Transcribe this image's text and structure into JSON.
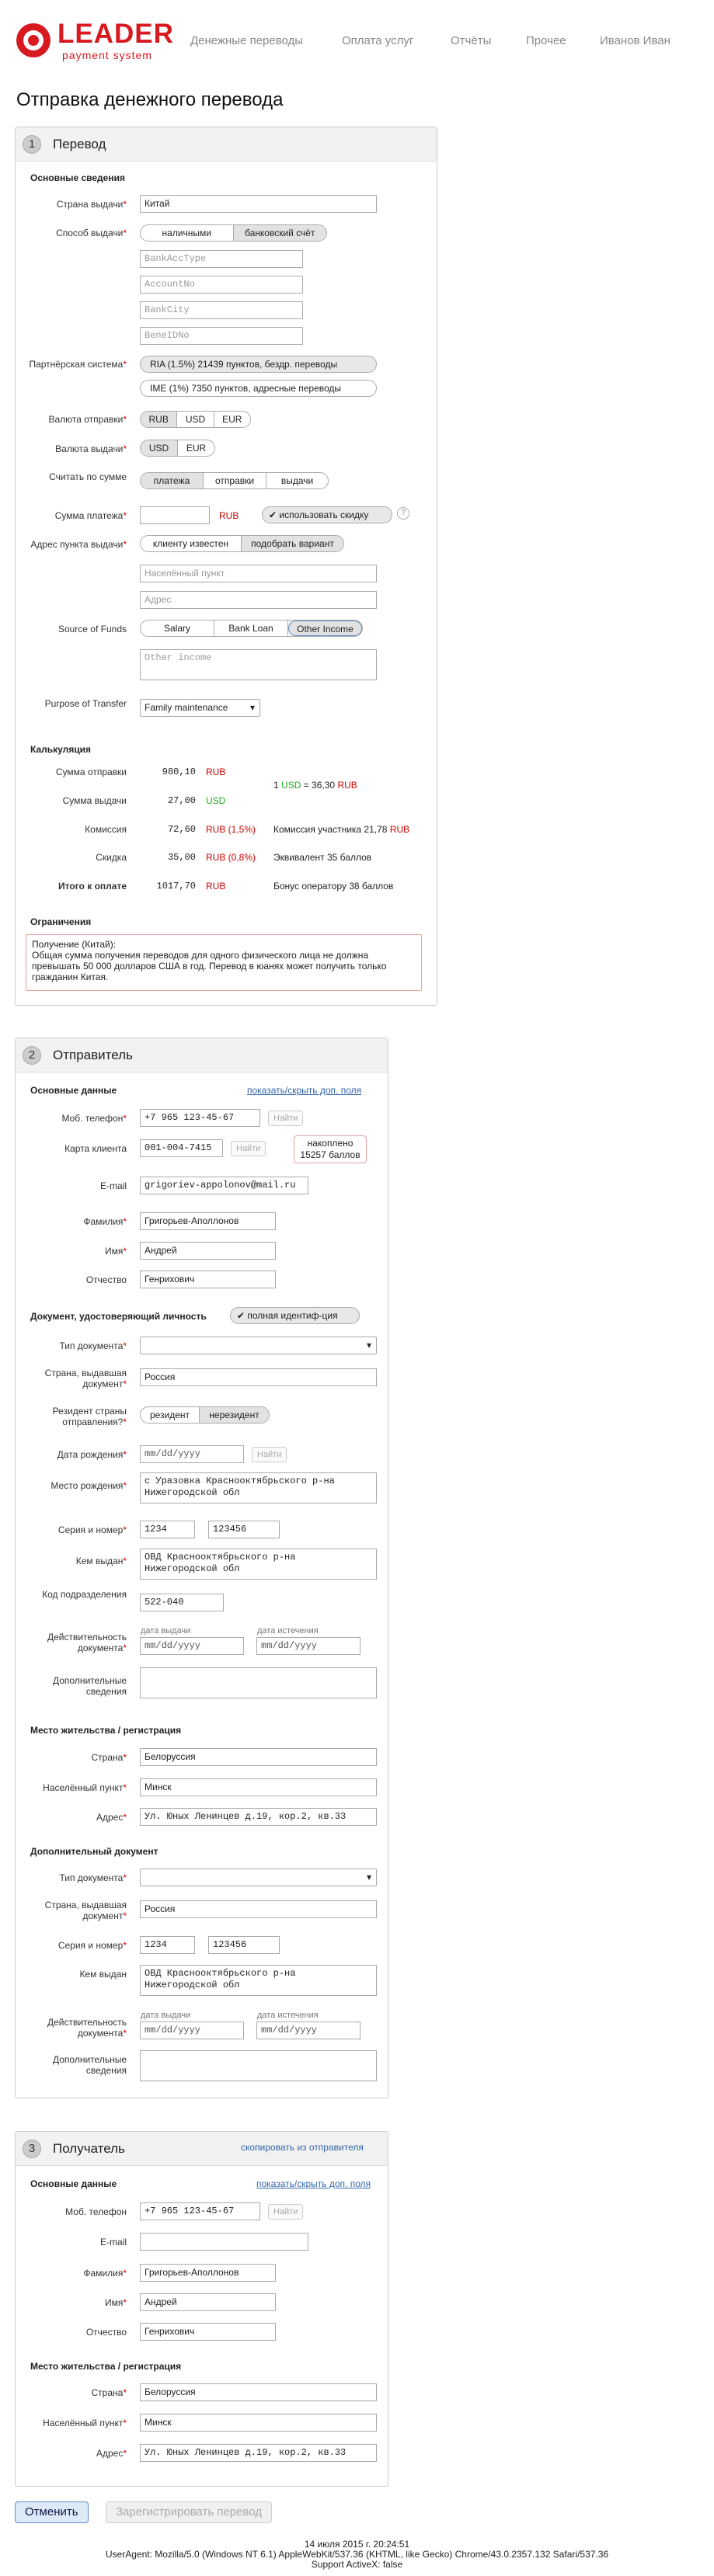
{
  "brand": {
    "name": "LEADER",
    "sub": "payment system"
  },
  "nav": [
    "Денежные переводы",
    "Оплата услуг",
    "Отчёты",
    "Прочее",
    "Иванов Иван"
  ],
  "page_title": "Отправка денежного перевода",
  "s1": {
    "num": "1",
    "title": "Перевод",
    "basic": "Основные сведения",
    "country_label": "Страна выдачи",
    "country": "Китай",
    "method_label": "Способ выдачи",
    "methods": [
      "наличными",
      "банковский счёт"
    ],
    "bank_fields": [
      "BankAccType",
      "AccountNo",
      "BankCity",
      "BeneIDNo"
    ],
    "partner_label": "Партнёрская система",
    "partners": [
      "RIA (1.5%) 21439 пунктов, бездр. переводы",
      "IME (1%) 7350 пунктов, адресные переводы"
    ],
    "send_cur_label": "Валюта отправки",
    "send_curs": [
      "RUB",
      "USD",
      "EUR"
    ],
    "pay_cur_label": "Валюта выдачи",
    "pay_curs": [
      "USD",
      "EUR"
    ],
    "calc_label": "Считать по сумме",
    "calc_opts": [
      "платежа",
      "отправки",
      "выдачи"
    ],
    "amount_label": "Сумма платежа",
    "amount_cur": "RUB",
    "use_discount": "использовать скидку",
    "help": "?",
    "addr_label": "Адрес пункта выдачи",
    "addr_opts": [
      "клиенту известен",
      "подобрать вариант"
    ],
    "addr_ph": [
      "Населённый пункт",
      "Адрес"
    ],
    "sof_label": "Source of Funds",
    "sof_opts": [
      "Salary",
      "Bank Loan",
      "Other Income"
    ],
    "other_ph": "Other income",
    "purpose_label": "Purpose of Transfer",
    "purpose": "Family maintenance",
    "calc_title": "Калькуляция",
    "calc_rows": [
      {
        "label": "Сумма отправки",
        "val": "980,10",
        "cur": "RUB"
      },
      {
        "label": "Сумма выдачи",
        "val": "27,00",
        "cur": "USD"
      },
      {
        "label": "Комиссия",
        "val": "72,60",
        "cur": "RUB (1,5%)"
      },
      {
        "label": "Скидка",
        "val": "35,00",
        "cur": "RUB (0,8%)"
      },
      {
        "label": "Итого к оплате",
        "val": "1017,70",
        "cur": "RUB"
      }
    ],
    "rate": [
      "1",
      "USD",
      "= 36,30",
      "RUB"
    ],
    "commission_note": [
      "Комиссия участника 21,78",
      "RUB"
    ],
    "equiv": "Эквивалент 35 баллов",
    "bonus": "Бонус оператору 38 баллов",
    "restr_title": "Ограничения",
    "restr_text": "Получение (Китай):\nОбщая сумма получения переводов для одного физического лица не должна превышать 50 000 долларов США в год. Перевод в юанях может получить только гражданин Китая."
  },
  "s2": {
    "num": "2",
    "title": "Отправитель",
    "basic": "Основные данные",
    "toggle": "показать/скрыть доп. поля",
    "phone_label": "Моб. телефон",
    "phone": "+7 965 123-45-67",
    "find": "Найти",
    "card_label": "Карта клиента",
    "card": "001-004-7415",
    "accum": "накоплено 15257 баллов",
    "email_label": "E-mail",
    "email": "grigoriev-appolonov@mail.ru",
    "last_label": "Фамилия",
    "last": "Григорьев-Аполлонов",
    "first_label": "Имя",
    "first": "Андрей",
    "mid_label": "Отчество",
    "mid": "Генрихович",
    "doc_title": "Документ, удостоверяющий личность",
    "full_id": "полная идентиф-ция",
    "doctype_label": "Тип документа",
    "issuer_country_label": "Страна, выдавшая документ",
    "issuer_country": "Россия",
    "resident_label": "Резидент страны отправления?",
    "resident_opts": [
      "резидент",
      "нерезидент"
    ],
    "dob_label": "Дата рождения",
    "date_ph": "mm/dd/yyyy",
    "pob_label": "Место рождения",
    "pob": "с Уразовка Краснооктябрьского р-на Нижегородской обл",
    "series_label": "Серия и номер",
    "series": "1234",
    "number": "123456",
    "issued_by_label": "Кем выдан",
    "issued_by": "ОВД Краснооктябрьского р-на Нижегородской обл",
    "code_label": "Код подразделения",
    "code": "522-040",
    "valid_label": "Действительность документа",
    "issue_date": "дата выдачи",
    "exp_date": "дата истечения",
    "extra_label": "Дополнительные сведения",
    "res_title": "Место жительства / регистрация",
    "country_label": "Страна",
    "country": "Белоруссия",
    "city_label": "Населённый пункт",
    "city": "Минск",
    "address_label": "Адрес",
    "address": "Ул. Юных Ленинцев д.19, кор.2, кв.33",
    "add_doc_title": "Дополнительный документ"
  },
  "s3": {
    "num": "3",
    "title": "Получатель",
    "copy": "скопировать из отправителя",
    "basic": "Основные данные",
    "toggle": "показать/скрыть доп. поля",
    "phone_label": "Моб. телефон",
    "phone": "+7 965 123-45-67",
    "find": "Найти",
    "email_label": "E-mail",
    "last_label": "Фамилия",
    "last": "Григорьев-Аполлонов",
    "first_label": "Имя",
    "first": "Андрей",
    "mid_label": "Отчество",
    "mid": "Генрихович",
    "res_title": "Место жительства / регистрация",
    "country_label": "Страна",
    "country": "Белоруссия",
    "city_label": "Населённый пункт",
    "city": "Минск",
    "address_label": "Адрес",
    "address": "Ул. Юных Ленинцев д.19, кор.2, кв.33"
  },
  "actions": {
    "cancel": "Отменить",
    "register": "Зарегистрировать перевод"
  },
  "footer": {
    "date": "14 июля 2015 г. 20:24:51",
    "ua": "UserAgent: Mozilla/5.0 (Windows NT 6.1) AppleWebKit/537.36 (KHTML, like Gecko) Chrome/43.0.2357.132 Safari/537.36",
    "activex": "Support ActiveX: false"
  },
  "colors": {
    "brand": "#d71920",
    "link": "#3366aa"
  }
}
